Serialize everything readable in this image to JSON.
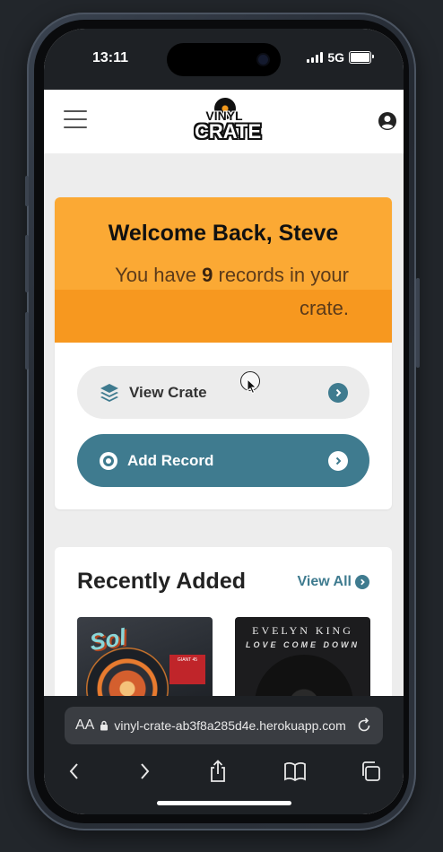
{
  "status_bar": {
    "time": "13:11",
    "network": "5G"
  },
  "header": {
    "logo_top": "VINYL",
    "logo_bottom": "CRATE"
  },
  "welcome": {
    "title": "Welcome Back, Steve",
    "text_prefix": "You have ",
    "record_count": "9",
    "text_suffix": " records in your crate."
  },
  "actions": {
    "view_crate_label": "View Crate",
    "add_record_label": "Add Record"
  },
  "recent": {
    "title": "Recently Added",
    "view_all_label": "View All",
    "albums": [
      {
        "artist": "",
        "title": ""
      },
      {
        "artist": "EVELYN KING",
        "title": "LOVE COME DOWN"
      }
    ]
  },
  "browser": {
    "aa_label": "AA",
    "url": "vinyl-crate-ab3f8a285d4e.herokuapp.com"
  },
  "colors": {
    "accent": "#3f7b8f",
    "banner": "#fba934",
    "banner_dark": "#f7981f"
  }
}
